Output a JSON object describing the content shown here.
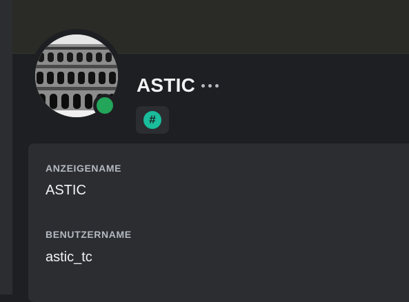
{
  "profile": {
    "display_name": "ASTIC",
    "more_icon": "more-horizontal-icon",
    "badge_icon": "hashtag-icon",
    "badge_symbol": "#",
    "badge_color": "#1abc9c",
    "status": "online",
    "status_color": "#23a55a"
  },
  "info": {
    "display_name_label": "ANZEIGENAME",
    "display_name_value": "ASTIC",
    "username_label": "BENUTZERNAME",
    "username_value": "astic_tc"
  }
}
